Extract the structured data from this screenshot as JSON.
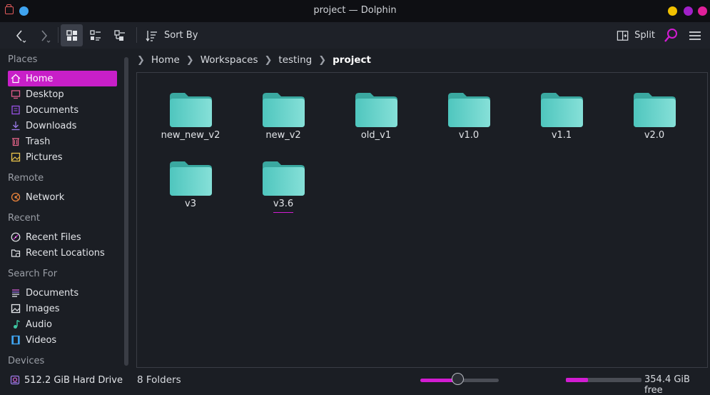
{
  "window": {
    "title": "project — Dolphin",
    "controls": {
      "minimize_color": "#f0c000",
      "maximize_color": "#a020c8",
      "close_color": "#e0209a"
    }
  },
  "toolbar": {
    "back_label": "Back",
    "forward_label": "Forward",
    "sort_label": "Sort By",
    "split_label": "Split",
    "active_view": "icons",
    "accent": "#d21cd2"
  },
  "sidebar": {
    "sections": [
      {
        "title": "Places",
        "items": [
          {
            "label": "Home",
            "icon": "home-icon",
            "selected": true
          },
          {
            "label": "Desktop",
            "icon": "desktop-icon"
          },
          {
            "label": "Documents",
            "icon": "documents-icon"
          },
          {
            "label": "Downloads",
            "icon": "downloads-icon"
          },
          {
            "label": "Trash",
            "icon": "trash-icon"
          },
          {
            "label": "Pictures",
            "icon": "pictures-icon"
          }
        ]
      },
      {
        "title": "Remote",
        "items": [
          {
            "label": "Network",
            "icon": "network-icon"
          }
        ]
      },
      {
        "title": "Recent",
        "items": [
          {
            "label": "Recent Files",
            "icon": "recent-files-icon"
          },
          {
            "label": "Recent Locations",
            "icon": "recent-locations-icon"
          }
        ]
      },
      {
        "title": "Search For",
        "items": [
          {
            "label": "Documents",
            "icon": "search-documents-icon"
          },
          {
            "label": "Images",
            "icon": "images-icon"
          },
          {
            "label": "Audio",
            "icon": "audio-icon"
          },
          {
            "label": "Videos",
            "icon": "videos-icon"
          }
        ]
      },
      {
        "title": "Devices",
        "items": [
          {
            "label": "512.2 GiB Hard Drive",
            "icon": "hard-drive-icon"
          }
        ]
      }
    ]
  },
  "breadcrumb": [
    "Home",
    "Workspaces",
    "testing",
    "project"
  ],
  "folders": [
    {
      "name": "new_new_v2"
    },
    {
      "name": "new_v2"
    },
    {
      "name": "old_v1"
    },
    {
      "name": "v1.0"
    },
    {
      "name": "v1.1"
    },
    {
      "name": "v2.0"
    },
    {
      "name": "v3"
    },
    {
      "name": "v3.6",
      "focused": true
    }
  ],
  "status": {
    "summary": "8 Folders",
    "zoom_fraction": 0.48,
    "disk_used_fraction": 0.29,
    "free_space": "354.4 GiB free"
  },
  "colors": {
    "accent": "#d21cd2",
    "folder": "#5fd0c8",
    "background": "#1b1e24"
  }
}
